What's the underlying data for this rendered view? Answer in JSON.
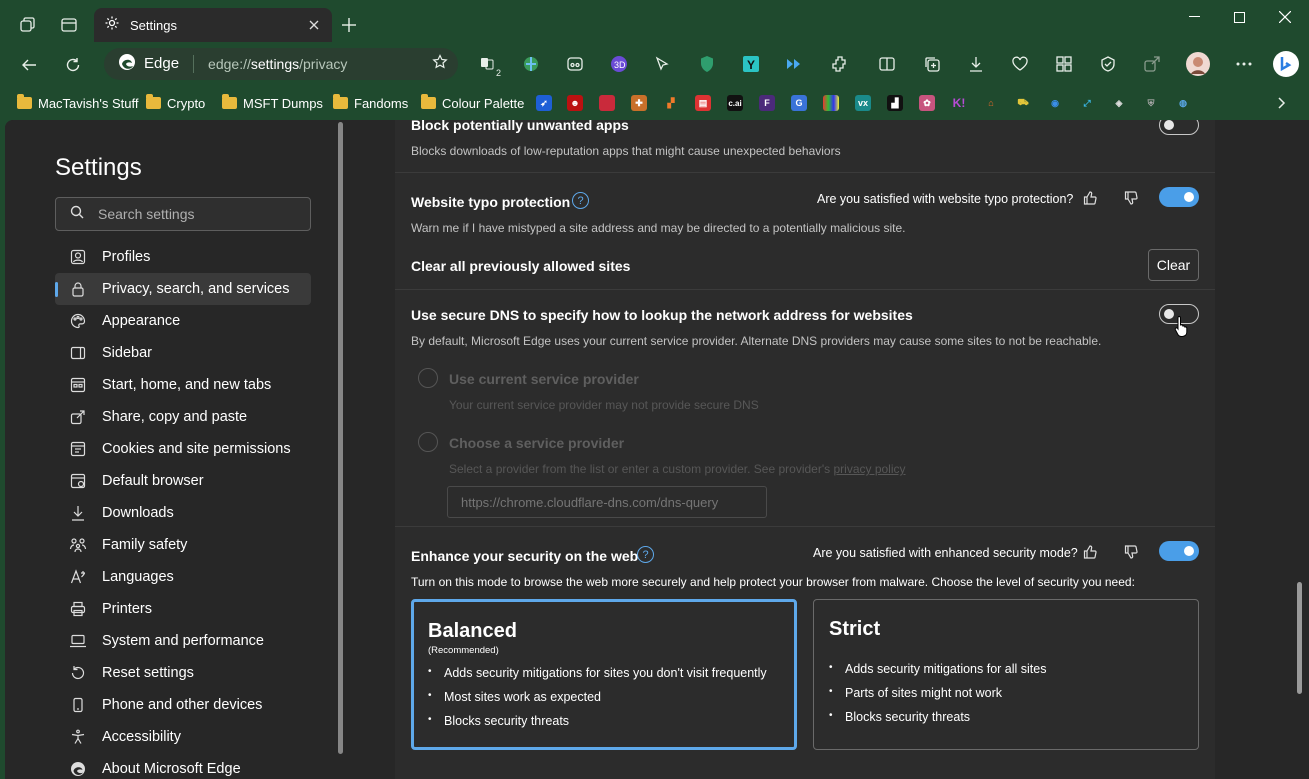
{
  "tab": {
    "title": "Settings"
  },
  "address": {
    "site_label": "Edge",
    "url_prefix": "edge://",
    "url_host": "settings",
    "url_path": "/privacy"
  },
  "favorites": {
    "folders": [
      "MacTavish's Stuff",
      "Crypto",
      "MSFT Dumps",
      "Fandoms",
      "Colour Palette"
    ],
    "icon_texts": [
      "c.ai",
      "F",
      "K!"
    ]
  },
  "extensions": {
    "badge_count": "2"
  },
  "sidebar": {
    "title": "Settings",
    "search_placeholder": "Search settings",
    "items": [
      {
        "label": "Profiles",
        "icon": "profile-icon"
      },
      {
        "label": "Privacy, search, and services",
        "icon": "lock-icon",
        "active": true
      },
      {
        "label": "Appearance",
        "icon": "palette-icon"
      },
      {
        "label": "Sidebar",
        "icon": "sidebar-icon"
      },
      {
        "label": "Start, home, and new tabs",
        "icon": "home-icon"
      },
      {
        "label": "Share, copy and paste",
        "icon": "share-icon"
      },
      {
        "label": "Cookies and site permissions",
        "icon": "cookie-icon"
      },
      {
        "label": "Default browser",
        "icon": "browser-icon"
      },
      {
        "label": "Downloads",
        "icon": "download-icon"
      },
      {
        "label": "Family safety",
        "icon": "family-icon"
      },
      {
        "label": "Languages",
        "icon": "language-icon"
      },
      {
        "label": "Printers",
        "icon": "printer-icon"
      },
      {
        "label": "System and performance",
        "icon": "laptop-icon"
      },
      {
        "label": "Reset settings",
        "icon": "reset-icon"
      },
      {
        "label": "Phone and other devices",
        "icon": "phone-icon"
      },
      {
        "label": "Accessibility",
        "icon": "accessibility-icon"
      },
      {
        "label": "About Microsoft Edge",
        "icon": "edge-icon"
      }
    ]
  },
  "main": {
    "pua": {
      "title": "Block potentially unwanted apps",
      "desc": "Blocks downloads of low-reputation apps that might cause unexpected behaviors",
      "enabled": false
    },
    "typo": {
      "title": "Website typo protection",
      "question": "Are you satisfied with website typo protection?",
      "desc": "Warn me if I have mistyped a site address and may be directed to a potentially malicious site.",
      "enabled": true
    },
    "clear_sites": {
      "title": "Clear all previously allowed sites",
      "button": "Clear"
    },
    "dns": {
      "title": "Use secure DNS to specify how to lookup the network address for websites",
      "desc": "By default, Microsoft Edge uses your current service provider. Alternate DNS providers may cause some sites to not be reachable.",
      "enabled": false,
      "option1_title": "Use current service provider",
      "option1_desc": "Your current service provider may not provide secure DNS",
      "option2_title": "Choose a service provider",
      "option2_desc": "Select a provider from the list or enter a custom provider. See provider's",
      "option2_link": "privacy policy",
      "provider_placeholder": "https://chrome.cloudflare-dns.com/dns-query"
    },
    "enhance": {
      "title": "Enhance your security on the web",
      "question": "Are you satisfied with enhanced security mode?",
      "desc": "Turn on this mode to browse the web more securely and help protect your browser from malware. Choose the level of security you need:",
      "enabled": true,
      "balanced": {
        "title": "Balanced",
        "subtitle": "(Recommended)",
        "bullets": [
          "Adds security mitigations for sites you don't visit frequently",
          "Most sites work as expected",
          "Blocks security threats"
        ]
      },
      "strict": {
        "title": "Strict",
        "bullets": [
          "Adds security mitigations for all sites",
          "Parts of sites might not work",
          "Blocks security threats"
        ]
      }
    }
  },
  "colors": {
    "accent": "#4a9ee8",
    "titlebar": "#1f4a2e",
    "panel": "#2c2c2c",
    "page": "#272727"
  }
}
